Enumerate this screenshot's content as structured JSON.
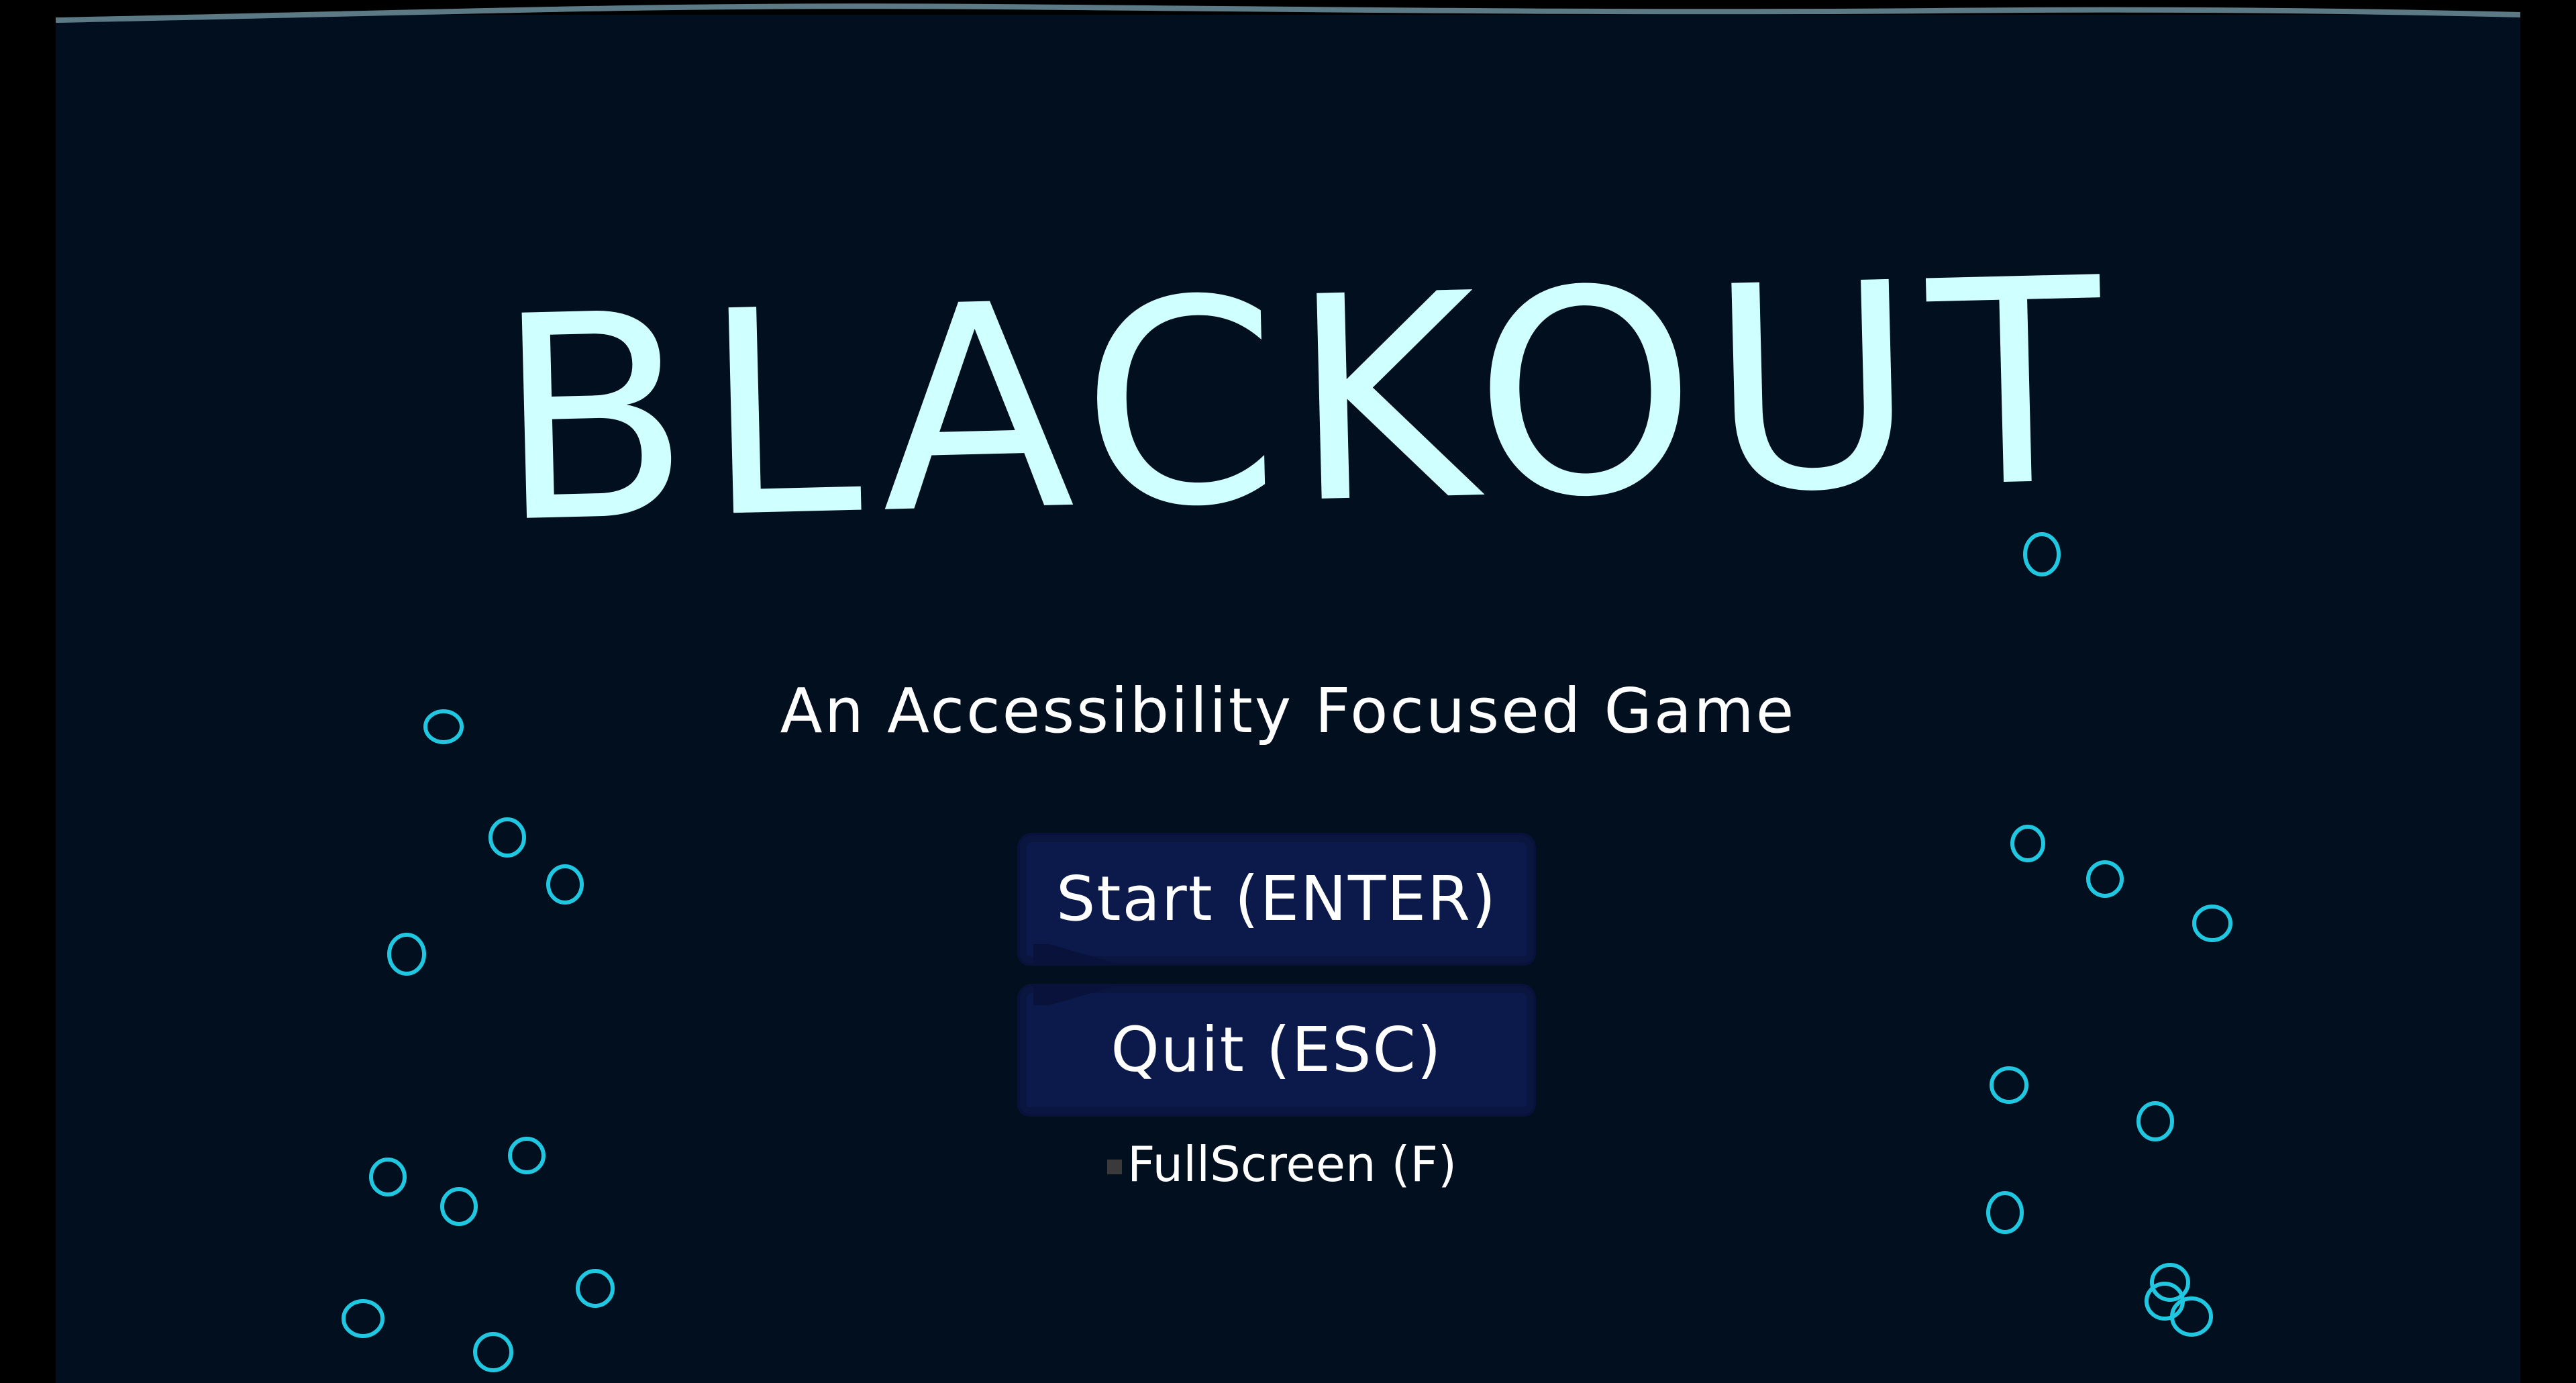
{
  "game": {
    "title": "BLACKOUT",
    "subtitle": "An Accessibility Focused Game"
  },
  "menu": {
    "start_label": "Start (ENTER)",
    "quit_label": "Quit (ESC)",
    "fullscreen_label": "FullScreen (F)",
    "fullscreen_checked": false
  },
  "colors": {
    "background": "#010f1f",
    "letterbox": "#000000",
    "title": "#cfffff",
    "button_fill": "#0b1a4a",
    "bubble_stroke": "#1fc8e0",
    "text": "#ffffff"
  },
  "icons": {
    "bubble": "bubble-icon",
    "checkbox": "checkbox-icon"
  }
}
